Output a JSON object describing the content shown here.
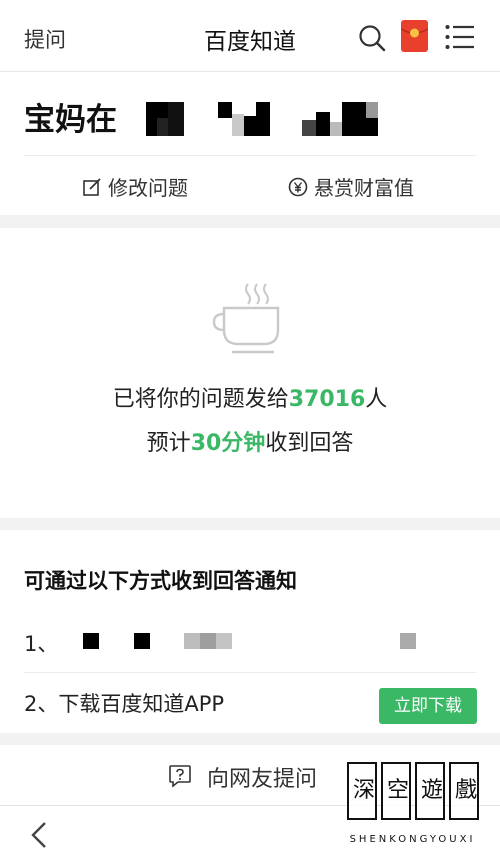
{
  "header": {
    "ask_label": "提问",
    "title": "百度知道",
    "icons": [
      "search-icon",
      "red-packet-icon",
      "menu-icon"
    ]
  },
  "question": {
    "title_prefix": "宝妈在",
    "edit_label": "修改问题",
    "reward_label": "悬赏财富值"
  },
  "status": {
    "line1_prefix": "已将你的问题发给",
    "line1_count": "37016",
    "line1_suffix": "人",
    "line2_prefix": "预计",
    "line2_time": "30分钟",
    "line2_suffix": "收到回答"
  },
  "notify": {
    "title": "可通过以下方式收到回答通知",
    "item1_prefix": "1、",
    "item2": "2、下载百度知道APP",
    "download_label": "立即下载"
  },
  "footer": {
    "ask_friends_label": "向网友提问"
  },
  "watermark": {
    "chars": [
      "深",
      "空",
      "遊",
      "戲"
    ],
    "text": "SHENKONGYOUXI"
  },
  "colors": {
    "accent_green": "#3bb866",
    "background": "#f2f2f2"
  }
}
